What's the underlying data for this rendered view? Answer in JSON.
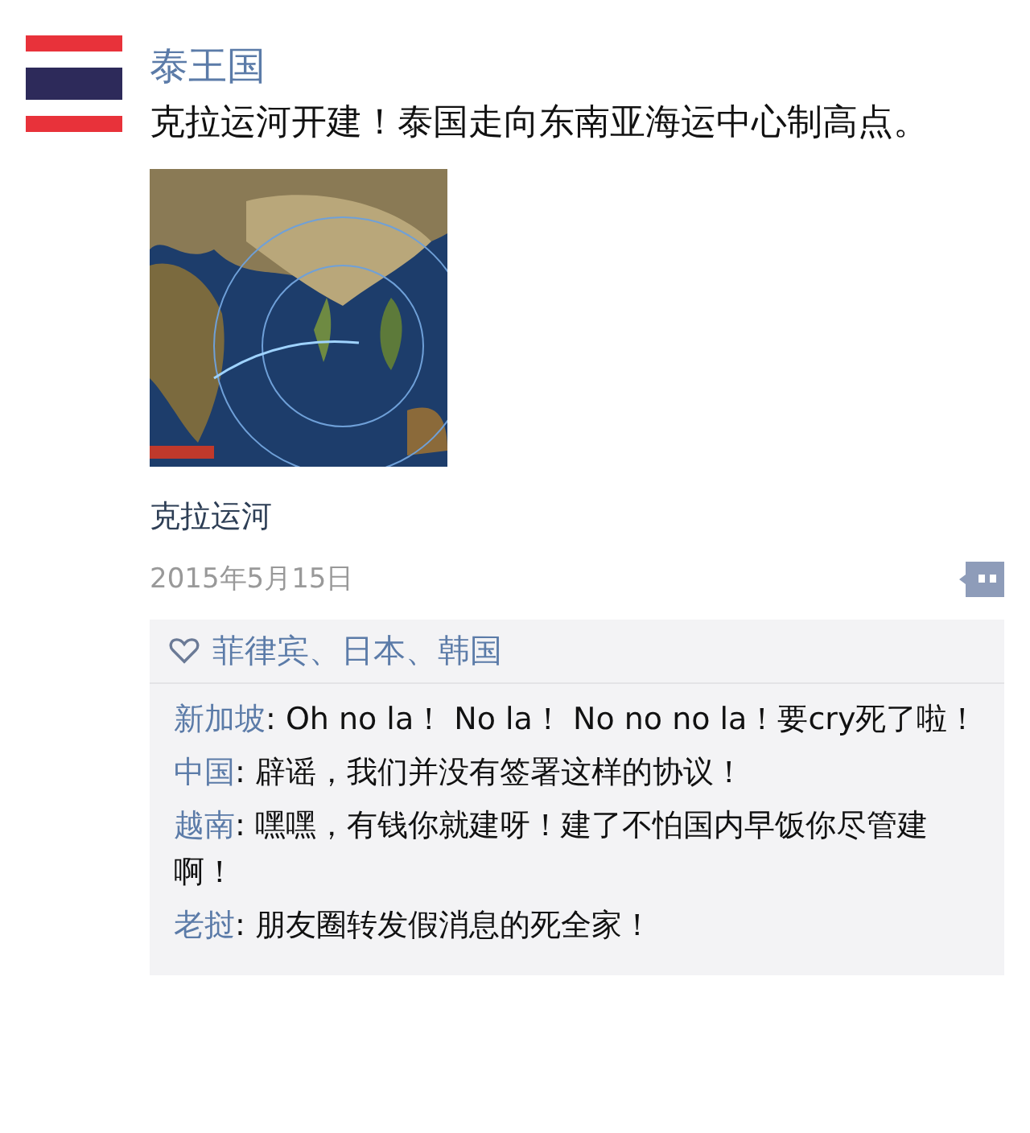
{
  "post": {
    "author": "泰王国",
    "text": "克拉运河开建！泰国走向东南亚海运中心制高点。",
    "caption": "克拉运河",
    "date": "2015年5月15日"
  },
  "likes": {
    "names": "菲律宾、日本、韩国"
  },
  "comments": [
    {
      "name": "新加坡",
      "text": ": Oh no la！ No la！  No no no la！要cry死了啦！"
    },
    {
      "name": "中国",
      "text": ": 辟谣，我们并没有签署这样的协议！"
    },
    {
      "name": "越南",
      "text": ": 嘿嘿，有钱你就建呀！建了不怕国内早饭你尽管建啊！"
    },
    {
      "name": "老挝",
      "text": ": 朋友圈转发假消息的死全家！"
    }
  ]
}
